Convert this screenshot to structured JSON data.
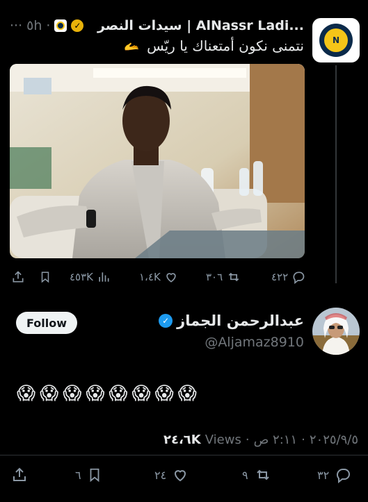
{
  "quoted_tweet": {
    "time": "٥h",
    "display_name": "سيدات النصر | AlNassr Ladi...",
    "text": "نتمنى نكون أمتعناك يا ريّس",
    "emoji": "🫴",
    "stats": {
      "replies": "٤٢٢",
      "reposts": "٣٠٦",
      "likes": "١،٤K",
      "views": "٤٥٣K"
    }
  },
  "reply_tweet": {
    "display_name": "عبدالرحمن الجماز",
    "handle": "@Aljamaz8910",
    "follow_label": "Follow",
    "body_emojis": "😱😱😱😱😱😱😱😱",
    "meta": {
      "date": "٢٠٢٥/٩/٥",
      "time": "٢:١١ ص",
      "views_count": "٢٤،٦K",
      "views_label": "Views"
    },
    "stats": {
      "replies": "٣٢",
      "reposts": "٩",
      "likes": "٢٤",
      "bookmarks": "٦"
    }
  },
  "icons": [
    "reply-icon",
    "repost-icon",
    "like-icon",
    "views-icon",
    "bookmark-icon",
    "share-icon",
    "verified-icon",
    "gold-badge-icon"
  ],
  "colors": {
    "background": "#000000",
    "text": "#e7e9ea",
    "muted": "#71767b",
    "verified": "#1d9bf0",
    "gold": "#e8b20a"
  }
}
